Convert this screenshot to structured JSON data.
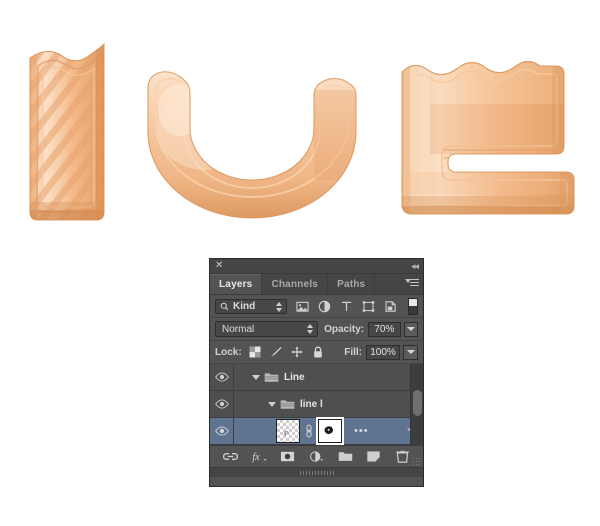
{
  "artwork": {
    "title": "IUE candy letters",
    "letters": [
      {
        "char": "I",
        "name": "letter-i-striped-bar"
      },
      {
        "char": "U",
        "name": "letter-u-crescent"
      },
      {
        "char": "E",
        "name": "letter-e-block"
      }
    ],
    "colors": {
      "highlight": "#fbe0c6",
      "light": "#f7cba4",
      "mid": "#f0b183",
      "dark": "#e0985f",
      "shadow": "#cf8449",
      "stripe": "#e8a46f"
    }
  },
  "panel": {
    "close_label": "✕",
    "collapse_label": "◂◂",
    "tabs": [
      {
        "label": "Layers",
        "active": true
      },
      {
        "label": "Channels",
        "active": false
      },
      {
        "label": "Paths",
        "active": false
      }
    ],
    "filter": {
      "kind_label": "Kind",
      "search_icon": "magnifier-icon",
      "icons": [
        {
          "name": "pixel-layer-filter-icon"
        },
        {
          "name": "adjustment-layer-filter-icon"
        },
        {
          "name": "type-layer-filter-icon"
        },
        {
          "name": "shape-layer-filter-icon"
        },
        {
          "name": "smart-object-filter-icon"
        }
      ],
      "toggle_name": "filter-enable-toggle"
    },
    "blend": {
      "mode": "Normal",
      "opacity_label": "Opacity:",
      "opacity_value": "70%"
    },
    "lock": {
      "label": "Lock:",
      "icons": [
        {
          "name": "lock-transparent-pixels-icon"
        },
        {
          "name": "lock-image-pixels-icon"
        },
        {
          "name": "lock-position-icon"
        },
        {
          "name": "lock-all-icon"
        }
      ],
      "fill_label": "Fill:",
      "fill_value": "100%"
    },
    "layers": [
      {
        "name": "Line",
        "type": "group",
        "indent": 0,
        "expanded": true,
        "visible": true,
        "selected": false
      },
      {
        "name": "line l",
        "type": "group",
        "indent": 1,
        "expanded": true,
        "visible": true,
        "selected": false
      },
      {
        "name": "",
        "type": "layer-with-mask",
        "indent": 2,
        "expanded": false,
        "visible": true,
        "selected": true,
        "ellipsis": "•••"
      }
    ],
    "bottom_icons": [
      {
        "name": "link-layers-icon"
      },
      {
        "name": "layer-style-fx-icon"
      },
      {
        "name": "add-layer-mask-icon"
      },
      {
        "name": "new-fill-adjustment-layer-icon"
      },
      {
        "name": "new-group-icon"
      },
      {
        "name": "new-layer-icon"
      },
      {
        "name": "delete-layer-icon"
      }
    ]
  }
}
